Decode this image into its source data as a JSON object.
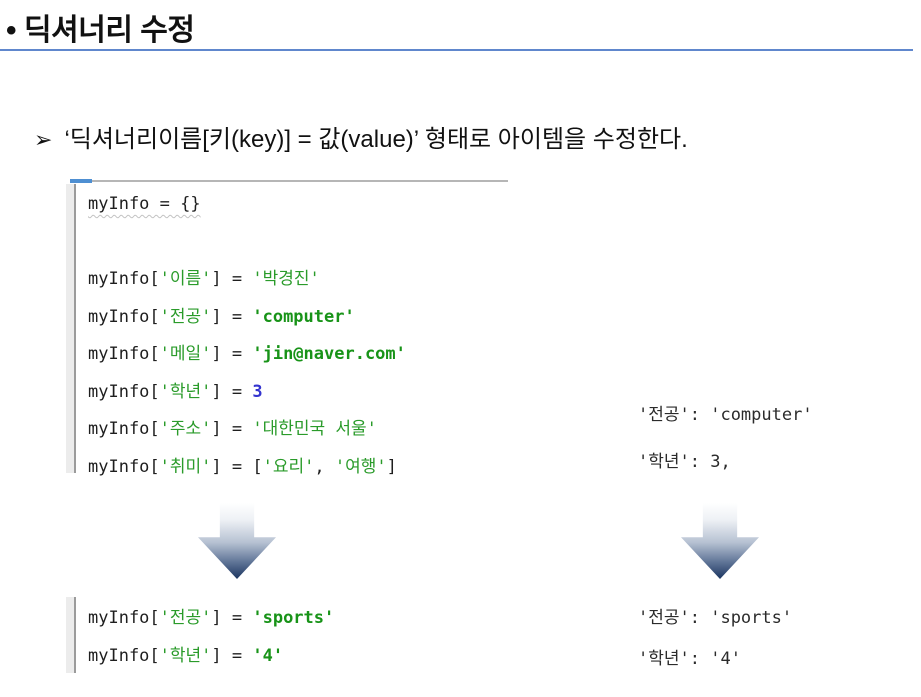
{
  "title": {
    "bullet": "•",
    "text": "딕셔너리 수정"
  },
  "subtitle": {
    "bullet": "➢",
    "text": "‘딕셔너리이름[키(key)] = 값(value)’ 형태로 아이템을 수정한다."
  },
  "colors": {
    "title_rule_blue": "#4472c4",
    "string_green": "#2a9b2a",
    "string_green_bold": "#189318",
    "number_blue": "#3434cf",
    "arrow_gradient_dark": "#1b3560",
    "ide_accent_blue": "#4e8fd2",
    "gutter_gray": "#9b9b9b"
  },
  "code_before": {
    "lines": [
      [
        {
          "t": "myInfo = {}",
          "c": "pw"
        }
      ],
      [],
      [
        {
          "t": "myInfo[",
          "c": "p"
        },
        {
          "t": "'이름'",
          "c": "s"
        },
        {
          "t": "] = ",
          "c": "p"
        },
        {
          "t": "'박경진'",
          "c": "s"
        }
      ],
      [
        {
          "t": "myInfo[",
          "c": "p"
        },
        {
          "t": "'전공'",
          "c": "s"
        },
        {
          "t": "] = ",
          "c": "p"
        },
        {
          "t": "'computer'",
          "c": "sb"
        }
      ],
      [
        {
          "t": "myInfo[",
          "c": "p"
        },
        {
          "t": "'메일'",
          "c": "s"
        },
        {
          "t": "] = ",
          "c": "p"
        },
        {
          "t": "'jin@naver.com'",
          "c": "sb"
        }
      ],
      [
        {
          "t": "myInfo[",
          "c": "p"
        },
        {
          "t": "'학년'",
          "c": "s"
        },
        {
          "t": "] = ",
          "c": "p"
        },
        {
          "t": "3",
          "c": "n"
        }
      ],
      [
        {
          "t": "myInfo[",
          "c": "p"
        },
        {
          "t": "'주소'",
          "c": "s"
        },
        {
          "t": "] = ",
          "c": "p"
        },
        {
          "t": "'대한민국 서울'",
          "c": "s"
        }
      ],
      [
        {
          "t": "myInfo[",
          "c": "p"
        },
        {
          "t": "'취미'",
          "c": "s"
        },
        {
          "t": "] = [",
          "c": "p"
        },
        {
          "t": "'요리'",
          "c": "s"
        },
        {
          "t": ", ",
          "c": "p"
        },
        {
          "t": "'여행'",
          "c": "s"
        },
        {
          "t": "]",
          "c": "p"
        }
      ]
    ]
  },
  "output_before": {
    "lines": [
      "'전공': 'computer'",
      "'학년': 3,"
    ]
  },
  "code_after": {
    "lines": [
      [
        {
          "t": "myInfo[",
          "c": "p"
        },
        {
          "t": "'전공'",
          "c": "s"
        },
        {
          "t": "] = ",
          "c": "p"
        },
        {
          "t": "'sports'",
          "c": "sb"
        }
      ],
      [
        {
          "t": "myInfo[",
          "c": "p"
        },
        {
          "t": "'학년'",
          "c": "s"
        },
        {
          "t": "] = ",
          "c": "p"
        },
        {
          "t": "'4'",
          "c": "sb"
        }
      ]
    ]
  },
  "output_after": {
    "lines": [
      "'전공': 'sports'",
      "'학년': '4'"
    ]
  }
}
